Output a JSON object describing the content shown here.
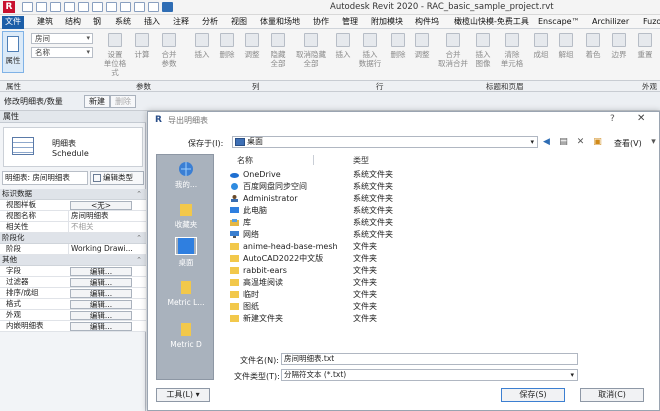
{
  "window": {
    "title": "Autodesk Revit 2020 - RAC_basic_sample_project.rvt"
  },
  "menu": {
    "tabs": [
      "文件",
      "建筑",
      "结构",
      "钢",
      "系统",
      "插入",
      "注释",
      "分析",
      "视图",
      "体量和场地",
      "协作",
      "管理",
      "附加模块",
      "构件坞",
      "橄榄山快模-免费工具",
      "Enscape™",
      "Archilizer",
      "Fuzo"
    ],
    "active_index": 0
  },
  "ribbon": {
    "properties_label": "属性",
    "combo1": "房间",
    "combo2": "名称",
    "buttons": [
      "设置\n单位格式",
      "计算",
      "合并\n参数",
      "插入",
      "删除",
      "调整",
      "隐藏\n全部",
      "取消隐藏\n全部",
      "插入",
      "插入\n数据行",
      "删除",
      "调整",
      "合并\n取消合并",
      "插入\n图像",
      "清除\n单元格",
      "成组",
      "解组",
      "着色",
      "边界",
      "重置"
    ],
    "group_labels": [
      "属性",
      "参数",
      "列",
      "行",
      "标题和页眉",
      "外观"
    ]
  },
  "modifybar": {
    "context": "修改明细表/数量",
    "new_btn": "新建",
    "delete_btn": "删除"
  },
  "properties": {
    "header": "属性",
    "type_line1": "明细表",
    "type_line2": "Schedule",
    "selector": "明细表: 房间明细表",
    "edit_type": "编辑类型",
    "sections": [
      {
        "title": "标识数据",
        "rows": [
          {
            "k": "视图样板",
            "v": "<无>",
            "style": "btn"
          },
          {
            "k": "视图名称",
            "v": "房间明细表",
            "style": "text"
          },
          {
            "k": "相关性",
            "v": "不相关",
            "style": "grey"
          }
        ]
      },
      {
        "title": "阶段化",
        "rows": [
          {
            "k": "阶段",
            "v": "Working Drawi...",
            "style": "text"
          }
        ]
      },
      {
        "title": "其他",
        "rows": [
          {
            "k": "字段",
            "v": "编辑...",
            "style": "btn"
          },
          {
            "k": "过滤器",
            "v": "编辑...",
            "style": "btn"
          },
          {
            "k": "排序/成组",
            "v": "编辑...",
            "style": "btn"
          },
          {
            "k": "格式",
            "v": "编辑...",
            "style": "btn"
          },
          {
            "k": "外观",
            "v": "编辑...",
            "style": "btn"
          },
          {
            "k": "内嵌明细表",
            "v": "编辑...",
            "style": "btn"
          }
        ]
      }
    ]
  },
  "dialog": {
    "title": "导出明细表",
    "help": "?",
    "close": "✕",
    "save_in_label": "保存于(I):",
    "save_in_value": "桌面",
    "view_label": "查看(V)",
    "places": [
      "我的...",
      "收藏夹",
      "桌面",
      "Metric L...",
      "Metric D"
    ],
    "col_name": "名称",
    "col_type": "类型",
    "items": [
      {
        "name": "OneDrive",
        "type": "系统文件夹",
        "icon": "cloud"
      },
      {
        "name": "百度网盘同步空间",
        "type": "系统文件夹",
        "icon": "baidu"
      },
      {
        "name": "Administrator",
        "type": "系统文件夹",
        "icon": "user"
      },
      {
        "name": "此电脑",
        "type": "系统文件夹",
        "icon": "pc"
      },
      {
        "name": "库",
        "type": "系统文件夹",
        "icon": "lib"
      },
      {
        "name": "网络",
        "type": "系统文件夹",
        "icon": "net"
      },
      {
        "name": "anime-head-base-mesh",
        "type": "文件夹",
        "icon": "folder"
      },
      {
        "name": "AutoCAD2022中文版",
        "type": "文件夹",
        "icon": "folder"
      },
      {
        "name": "rabbit-ears",
        "type": "文件夹",
        "icon": "folder"
      },
      {
        "name": "高温堆阅读",
        "type": "文件夹",
        "icon": "folder"
      },
      {
        "name": "临时",
        "type": "文件夹",
        "icon": "folder"
      },
      {
        "name": "图纸",
        "type": "文件夹",
        "icon": "folder"
      },
      {
        "name": "新建文件夹",
        "type": "文件夹",
        "icon": "folder"
      }
    ],
    "filename_label": "文件名(N):",
    "filename_value": "房间明细表.txt",
    "filetype_label": "文件类型(T):",
    "filetype_value": "分隔符文本 (*.txt)",
    "tools_btn": "工具(L)",
    "save_btn": "保存(S)",
    "cancel_btn": "取消(C)",
    "colors": {
      "accent": "#1c5ea8",
      "folder": "#f2c84b"
    }
  }
}
